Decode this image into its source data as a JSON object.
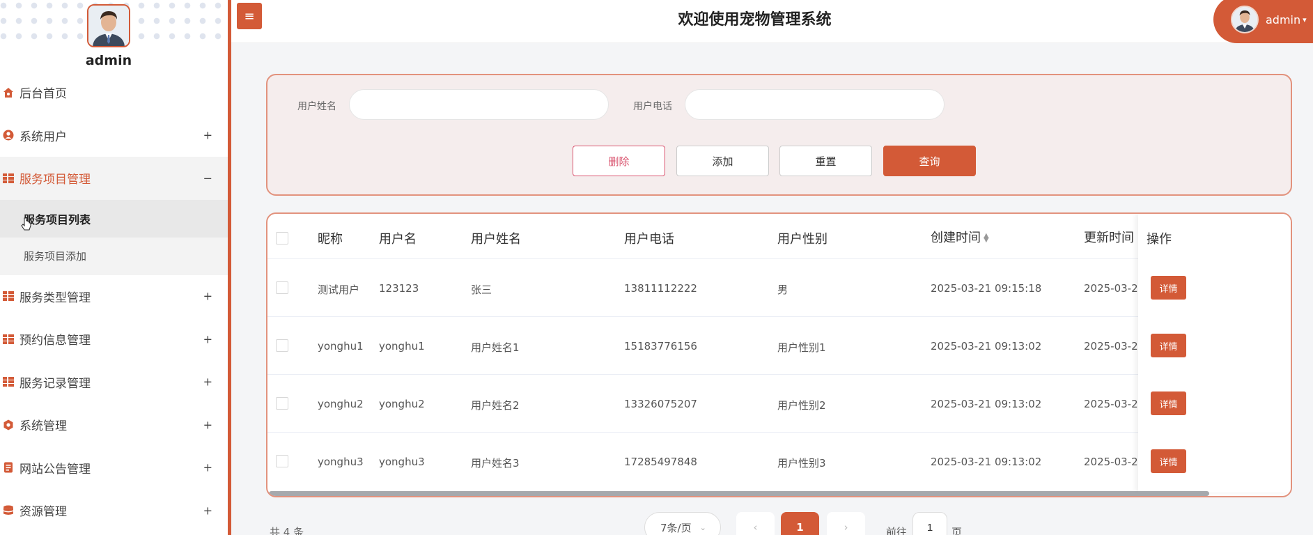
{
  "sidebar": {
    "user_name": "admin",
    "items": [
      {
        "label": "后台首页",
        "icon": "home-icon",
        "toggle": ""
      },
      {
        "label": "系统用户",
        "icon": "user-icon",
        "toggle": "+"
      },
      {
        "label": "服务项目管理",
        "icon": "grid-icon",
        "toggle": "−"
      },
      {
        "label": "服务类型管理",
        "icon": "grid-icon",
        "toggle": "+"
      },
      {
        "label": "预约信息管理",
        "icon": "grid-icon",
        "toggle": "+"
      },
      {
        "label": "服务记录管理",
        "icon": "grid-icon",
        "toggle": "+"
      },
      {
        "label": "系统管理",
        "icon": "gear-icon",
        "toggle": "+"
      },
      {
        "label": "网站公告管理",
        "icon": "document-icon",
        "toggle": "+"
      },
      {
        "label": "资源管理",
        "icon": "database-icon",
        "toggle": "+"
      }
    ],
    "submenu": [
      {
        "label": "服务项目列表"
      },
      {
        "label": "服务项目添加"
      }
    ]
  },
  "header": {
    "title": "欢迎使用宠物管理系统",
    "user_label": "admin"
  },
  "search": {
    "field1_label": "用户姓名",
    "field1_value": "",
    "field2_label": "用户电话",
    "field2_value": "",
    "delete_label": "删除",
    "add_label": "添加",
    "reset_label": "重置",
    "query_label": "查询"
  },
  "table": {
    "columns": [
      "昵称",
      "用户名",
      "用户姓名",
      "用户电话",
      "用户性别",
      "创建时间",
      "更新时间",
      "操作"
    ],
    "rows": [
      {
        "nickname": "测试用户",
        "username": "123123",
        "realname": "张三",
        "phone": "13811112222",
        "gender": "男",
        "created": "2025-03-21 09:15:18",
        "updated": "2025-03-2",
        "action": "详情"
      },
      {
        "nickname": "yonghu1",
        "username": "yonghu1",
        "realname": "用户姓名1",
        "phone": "15183776156",
        "gender": "用户性别1",
        "created": "2025-03-21 09:13:02",
        "updated": "2025-03-2",
        "action": "详情"
      },
      {
        "nickname": "yonghu2",
        "username": "yonghu2",
        "realname": "用户姓名2",
        "phone": "13326075207",
        "gender": "用户性别2",
        "created": "2025-03-21 09:13:02",
        "updated": "2025-03-2",
        "action": "详情"
      },
      {
        "nickname": "yonghu3",
        "username": "yonghu3",
        "realname": "用户姓名3",
        "phone": "17285497848",
        "gender": "用户性别3",
        "created": "2025-03-21 09:13:02",
        "updated": "2025-03-2",
        "action": "详情"
      }
    ]
  },
  "pagination": {
    "total": "共 4 条",
    "page_size": "7条/页",
    "current_page": "1",
    "goto_prefix": "前往",
    "goto_value": "1",
    "goto_suffix": "页"
  },
  "colors": {
    "accent": "#d35a37",
    "danger": "#d9536e"
  }
}
